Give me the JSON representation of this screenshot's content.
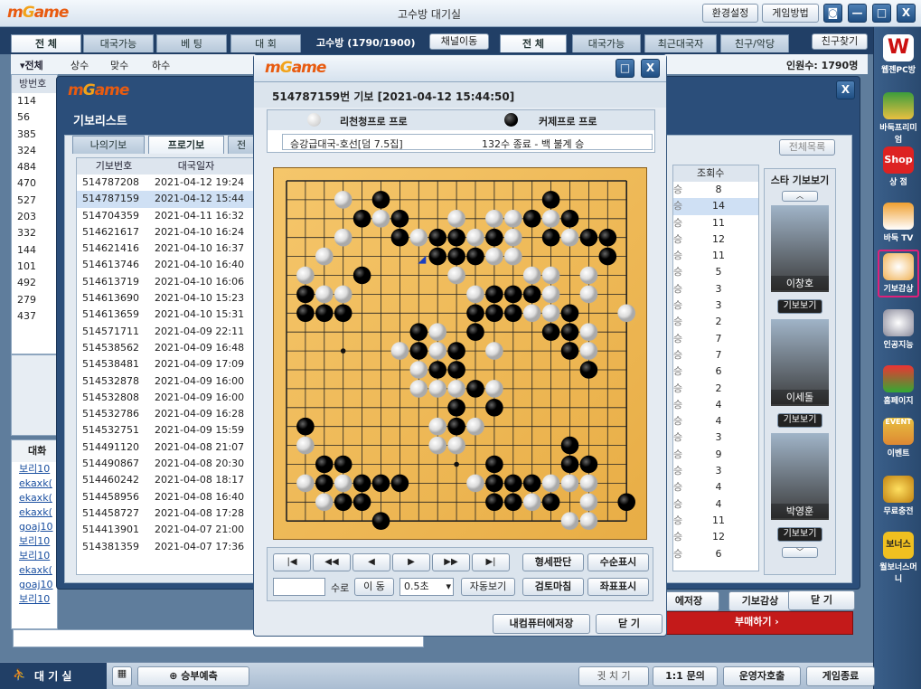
{
  "window": {
    "title": "고수방 대기실",
    "settings_btn": "환경설정",
    "howto_btn": "게임방법",
    "camera_icon": "camera-icon",
    "min": "—",
    "max": "□",
    "close": "X"
  },
  "lobby": {
    "tabs_left": [
      "전 체",
      "대국가능",
      "베 팅",
      "대 회"
    ],
    "room_label": "고수방 (1790/1900)",
    "channel_btn": "채널이동",
    "tabs_right": [
      "전 체",
      "대국가능",
      "최근대국자",
      "친구/악당"
    ],
    "friend_btn": "친구찾기",
    "filters": [
      "▾전체",
      "상수",
      "맞수",
      "하수"
    ],
    "user_count": "인원수: 1790명",
    "col_header": "방번호",
    "room_numbers": [
      "114",
      "56",
      "385",
      "324",
      "484",
      "470",
      "527",
      "203",
      "332",
      "144",
      "101",
      "492",
      "279",
      "437"
    ],
    "chat_title": "대화",
    "chat_names": [
      "보리10",
      "ekaxk(",
      "ekaxk(",
      "ekaxk(",
      "goaj10",
      "보리10",
      "보리10",
      "ekaxk(",
      "goaj10",
      "보리10"
    ],
    "close_x": "X"
  },
  "gibo_list": {
    "title": "기보리스트",
    "tabs": [
      "나의기보",
      "프로기보",
      "전"
    ],
    "col_no": "기보번호",
    "col_date": "대국일자",
    "rows": [
      [
        "514787208",
        "2021-04-12 19:24"
      ],
      [
        "514787159",
        "2021-04-12 15:44"
      ],
      [
        "514704359",
        "2021-04-11 16:32"
      ],
      [
        "514621617",
        "2021-04-10 16:24"
      ],
      [
        "514621416",
        "2021-04-10 16:37"
      ],
      [
        "514613746",
        "2021-04-10 16:40"
      ],
      [
        "514613719",
        "2021-04-10 16:06"
      ],
      [
        "514613690",
        "2021-04-10 15:23"
      ],
      [
        "514613659",
        "2021-04-10 15:31"
      ],
      [
        "514571711",
        "2021-04-09 22:11"
      ],
      [
        "514538562",
        "2021-04-09 16:48"
      ],
      [
        "514538481",
        "2021-04-09 17:09"
      ],
      [
        "514532878",
        "2021-04-09 16:00"
      ],
      [
        "514532808",
        "2021-04-09 16:00"
      ],
      [
        "514532786",
        "2021-04-09 16:28"
      ],
      [
        "514532751",
        "2021-04-09 15:59"
      ],
      [
        "514491120",
        "2021-04-08 21:07"
      ],
      [
        "514490867",
        "2021-04-08 20:30"
      ],
      [
        "514460242",
        "2021-04-08 18:17"
      ],
      [
        "514458956",
        "2021-04-08 16:40"
      ],
      [
        "514458727",
        "2021-04-08 17:28"
      ],
      [
        "514413901",
        "2021-04-07 21:00"
      ],
      [
        "514381359",
        "2021-04-07 17:36"
      ]
    ],
    "all_list_btn": "전체목록",
    "col_view": "조회수",
    "results": [
      "승",
      "승",
      "승",
      "승",
      "승",
      "승",
      "승",
      "승",
      "승",
      "승",
      "승",
      "승",
      "승",
      "승",
      "승",
      "승",
      "승",
      "승",
      "승",
      "승",
      "승",
      "승"
    ],
    "views": [
      "8",
      "14",
      "11",
      "12",
      "11",
      "5",
      "3",
      "3",
      "2",
      "7",
      "7",
      "6",
      "2",
      "4",
      "4",
      "3",
      "9",
      "3",
      "4",
      "4",
      "11",
      "12",
      "6"
    ],
    "star_title": "스타 기보보기",
    "stars": [
      {
        "name": "이창호",
        "btn": "기보보기"
      },
      {
        "name": "이세돌",
        "btn": "기보보기"
      },
      {
        "name": "박영훈",
        "btn": "기보보기"
      }
    ],
    "save_btn": "에저장",
    "review_btn": "기보감상",
    "close_btn": "닫 기",
    "bet_btn": "부매하기 ›"
  },
  "viewer": {
    "header": "514787159번 기보 [2021-04-12 15:44:50]",
    "white_player": "리천청프로 프로",
    "black_player": "커제프로 프로",
    "match": "승강급대국-호선[덤 7.5집]",
    "result": "132수 종료 - 백 불계 승",
    "nav": [
      "|◀",
      "◀◀",
      "◀",
      "▶",
      "▶▶",
      "▶|"
    ],
    "analyze": "형세판단",
    "show_moves": "수순표시",
    "move_unit": "수로",
    "goto": "이 동",
    "speed": "0.5초",
    "autoplay": "자동보기",
    "review_end": "검토마침",
    "coords": "좌표표시",
    "save_pc": "내컴퓨터에저장",
    "close": "닫 기"
  },
  "rightbar": {
    "items": [
      "웹젠PC방",
      "바둑프리미엄",
      "상 점",
      "바둑 TV",
      "기보감상",
      "인공지능",
      "홈페이지",
      "이벤트",
      "무료충전",
      "월보너스머니"
    ],
    "shop_label": "Shop",
    "event_label": "EVENT",
    "bonus_label": "보너스",
    "w_label": "W"
  },
  "bottom": {
    "lobby": "대 기 실",
    "predict": "승부예측",
    "whisper": "귓 치 기",
    "inquiry": "1:1 문의",
    "operator": "운영자호출",
    "exit": "게임종료"
  },
  "board": {
    "size": 19,
    "black": [
      [
        5,
        1
      ],
      [
        14,
        1
      ],
      [
        4,
        2
      ],
      [
        6,
        2
      ],
      [
        13,
        2
      ],
      [
        15,
        2
      ],
      [
        6,
        3
      ],
      [
        8,
        3
      ],
      [
        9,
        3
      ],
      [
        11,
        3
      ],
      [
        14,
        3
      ],
      [
        16,
        3
      ],
      [
        17,
        3
      ],
      [
        8,
        4
      ],
      [
        9,
        4
      ],
      [
        10,
        4
      ],
      [
        17,
        4
      ],
      [
        4,
        5
      ],
      [
        1,
        6
      ],
      [
        11,
        6
      ],
      [
        12,
        6
      ],
      [
        13,
        6
      ],
      [
        1,
        7
      ],
      [
        2,
        7
      ],
      [
        3,
        7
      ],
      [
        11,
        7
      ],
      [
        12,
        7
      ],
      [
        10,
        7
      ],
      [
        15,
        7
      ],
      [
        7,
        8
      ],
      [
        10,
        8
      ],
      [
        14,
        8
      ],
      [
        15,
        8
      ],
      [
        7,
        9
      ],
      [
        9,
        9
      ],
      [
        15,
        9
      ],
      [
        8,
        10
      ],
      [
        9,
        10
      ],
      [
        16,
        10
      ],
      [
        10,
        11
      ],
      [
        9,
        12
      ],
      [
        11,
        12
      ],
      [
        1,
        13
      ],
      [
        9,
        13
      ],
      [
        15,
        14
      ],
      [
        2,
        15
      ],
      [
        3,
        15
      ],
      [
        11,
        15
      ],
      [
        15,
        15
      ],
      [
        16,
        15
      ],
      [
        2,
        16
      ],
      [
        4,
        16
      ],
      [
        5,
        16
      ],
      [
        11,
        16
      ],
      [
        12,
        16
      ],
      [
        13,
        16
      ],
      [
        6,
        16
      ],
      [
        3,
        17
      ],
      [
        4,
        17
      ],
      [
        11,
        17
      ],
      [
        12,
        17
      ],
      [
        14,
        17
      ],
      [
        18,
        17
      ],
      [
        5,
        18
      ]
    ],
    "white": [
      [
        3,
        1
      ],
      [
        4,
        2
      ],
      [
        5,
        2
      ],
      [
        9,
        2
      ],
      [
        11,
        2
      ],
      [
        12,
        2
      ],
      [
        14,
        2
      ],
      [
        7,
        3
      ],
      [
        10,
        3
      ],
      [
        12,
        3
      ],
      [
        15,
        3
      ],
      [
        3,
        3
      ],
      [
        2,
        4
      ],
      [
        10,
        4
      ],
      [
        11,
        4
      ],
      [
        12,
        4
      ],
      [
        1,
        5
      ],
      [
        4,
        5
      ],
      [
        9,
        5
      ],
      [
        13,
        5
      ],
      [
        14,
        5
      ],
      [
        16,
        5
      ],
      [
        2,
        6
      ],
      [
        3,
        6
      ],
      [
        10,
        6
      ],
      [
        14,
        6
      ],
      [
        16,
        6
      ],
      [
        1,
        7
      ],
      [
        13,
        7
      ],
      [
        14,
        7
      ],
      [
        18,
        7
      ],
      [
        6,
        9
      ],
      [
        8,
        8
      ],
      [
        11,
        9
      ],
      [
        16,
        8
      ],
      [
        7,
        9
      ],
      [
        8,
        9
      ],
      [
        16,
        9
      ],
      [
        7,
        10
      ],
      [
        8,
        10
      ],
      [
        9,
        11
      ],
      [
        7,
        11
      ],
      [
        8,
        11
      ],
      [
        10,
        11
      ],
      [
        11,
        11
      ],
      [
        10,
        13
      ],
      [
        8,
        13
      ],
      [
        9,
        14
      ],
      [
        8,
        14
      ],
      [
        1,
        14
      ],
      [
        2,
        16
      ],
      [
        3,
        16
      ],
      [
        10,
        16
      ],
      [
        14,
        16
      ],
      [
        15,
        16
      ],
      [
        16,
        16
      ],
      [
        1,
        16
      ],
      [
        3,
        17
      ],
      [
        2,
        17
      ],
      [
        13,
        17
      ],
      [
        16,
        17
      ],
      [
        15,
        18
      ],
      [
        16,
        18
      ],
      [
        2,
        17
      ]
    ],
    "marked_stone": [
      7,
      4
    ]
  }
}
